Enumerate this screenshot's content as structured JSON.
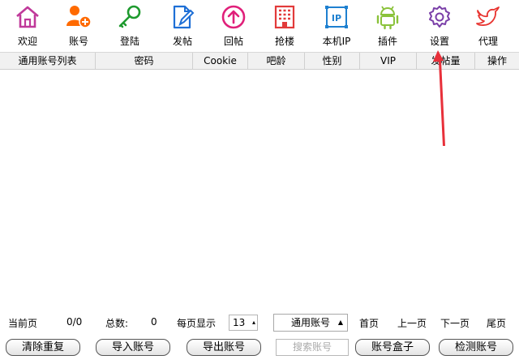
{
  "toolbar": {
    "items": [
      {
        "label": "欢迎",
        "icon": "home-icon"
      },
      {
        "label": "账号",
        "icon": "add-user-icon"
      },
      {
        "label": "登陆",
        "icon": "key-icon"
      },
      {
        "label": "发帖",
        "icon": "edit-document-icon"
      },
      {
        "label": "回帖",
        "icon": "upload-circle-icon"
      },
      {
        "label": "抢楼",
        "icon": "building-icon"
      },
      {
        "label": "本机IP",
        "icon": "ip-icon"
      },
      {
        "label": "插件",
        "icon": "android-icon"
      },
      {
        "label": "设置",
        "icon": "gear-icon"
      },
      {
        "label": "代理",
        "icon": "bird-icon"
      }
    ]
  },
  "table": {
    "columns": [
      "通用账号列表",
      "密码",
      "Cookie",
      "吧龄",
      "性别",
      "VIP",
      "发帖量",
      "操作"
    ]
  },
  "pager": {
    "current_label": "当前页",
    "current_value": "0/0",
    "total_label": "总数:",
    "total_value": "0",
    "per_page_label": "每页显示",
    "per_page_value": "13",
    "account_type": "通用账号",
    "first": "首页",
    "prev": "上一页",
    "next": "下一页",
    "last": "尾页"
  },
  "buttons": {
    "dedupe": "清除重复",
    "import": "导入账号",
    "export": "导出账号",
    "search_placeholder": "搜索账号",
    "box": "账号盒子",
    "check": "检测账号"
  },
  "colors": {
    "home": "#c0399a",
    "user": "#ff6a00",
    "key": "#1e9a2e",
    "edit": "#1e6fd6",
    "reply": "#e0207a",
    "building": "#e23a3a",
    "ip": "#1e80d0",
    "android": "#8ac23a",
    "gear": "#7a3fa8",
    "bird": "#e8332f",
    "annotation_arrow": "#e8303a"
  }
}
